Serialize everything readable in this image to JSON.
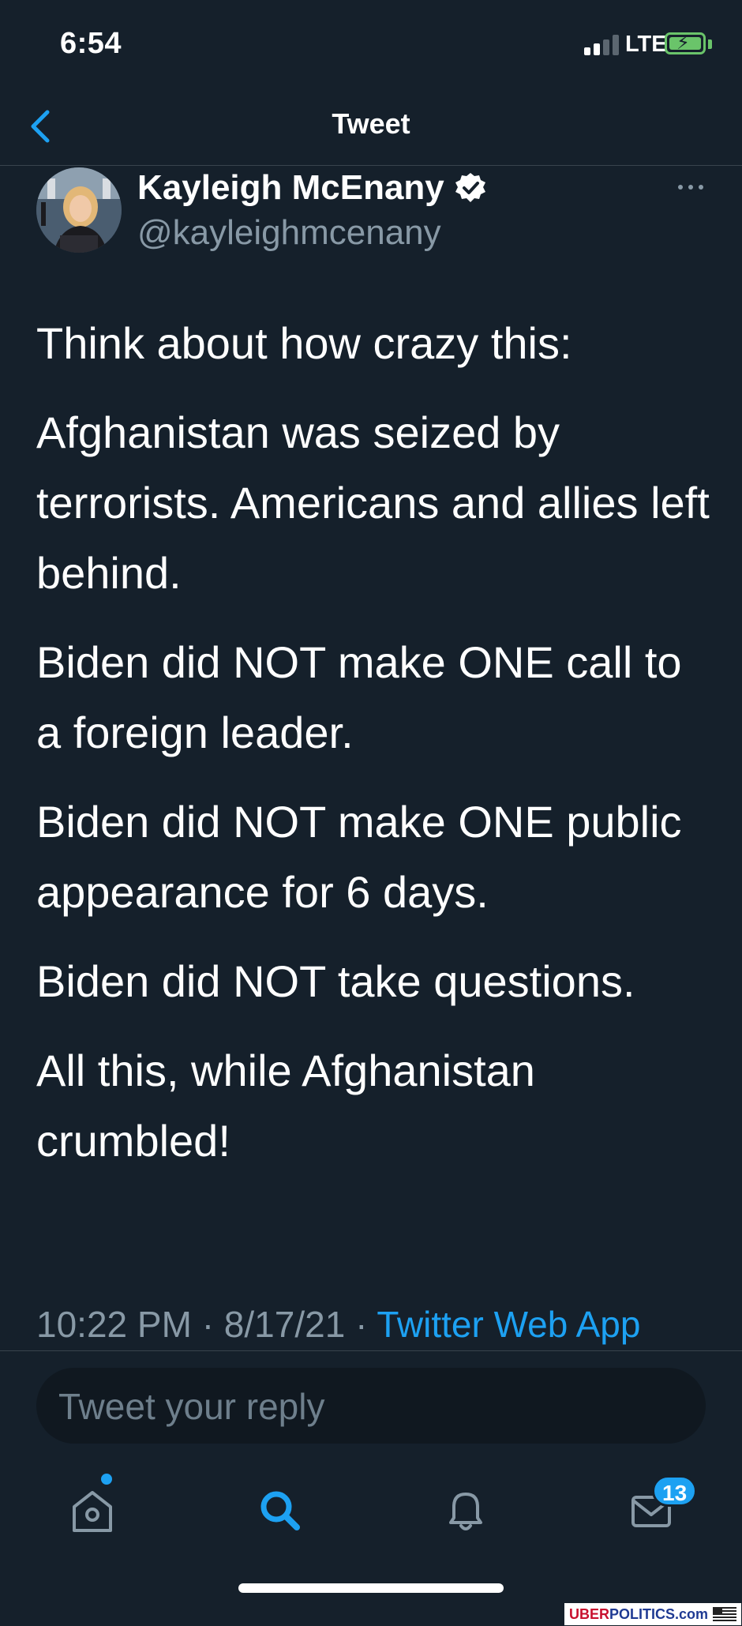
{
  "status_bar": {
    "time": "6:54",
    "network": "LTE"
  },
  "header": {
    "title": "Tweet",
    "back_icon": "chevron-left-icon"
  },
  "author": {
    "name": "Kayleigh McEnany",
    "handle": "@kayleighmcenany",
    "verified": true
  },
  "tweet": {
    "paragraphs": [
      "Think about how crazy this:",
      "Afghanistan was seized by terrorists. Americans and allies left behind.",
      "Biden did NOT make ONE call to a foreign leader.",
      "Biden did NOT make ONE public appearance for 6 days.",
      "Biden did NOT take questions.",
      "All this, while Afghanistan crumbled!"
    ],
    "time": "10:22 PM",
    "date": "8/17/21",
    "separator": "·",
    "source": "Twitter Web App"
  },
  "reply": {
    "placeholder": "Tweet your reply"
  },
  "tab_bar": {
    "tabs": [
      {
        "name": "home",
        "icon": "home-icon",
        "active": false,
        "has_dot": true
      },
      {
        "name": "search",
        "icon": "search-icon",
        "active": true
      },
      {
        "name": "notifications",
        "icon": "bell-icon",
        "active": false
      },
      {
        "name": "messages",
        "icon": "mail-icon",
        "active": false
      }
    ],
    "messages_badge": "13"
  },
  "watermark": {
    "part1": "UBER",
    "part2": "POLITICS.com"
  },
  "colors": {
    "background": "#15202b",
    "accent": "#1da1f2",
    "secondary_text": "#8899a6",
    "divider": "#38444d"
  }
}
